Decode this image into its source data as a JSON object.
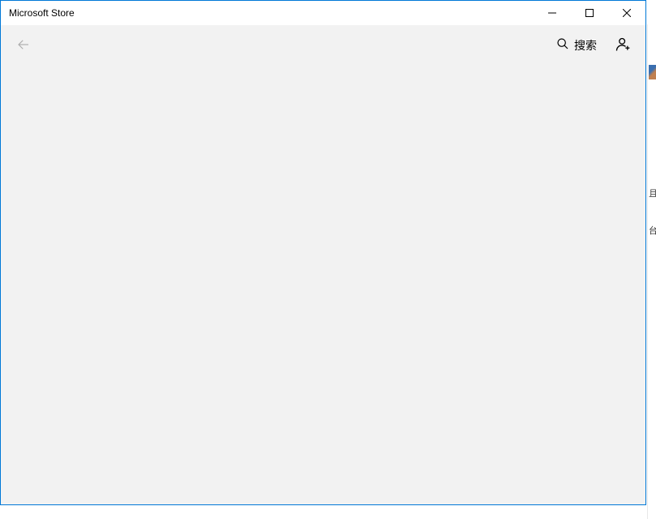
{
  "window": {
    "title": "Microsoft Store"
  },
  "toolbar": {
    "search_label": "搜索"
  },
  "edge": {
    "frag1": "且",
    "frag2": "台"
  }
}
